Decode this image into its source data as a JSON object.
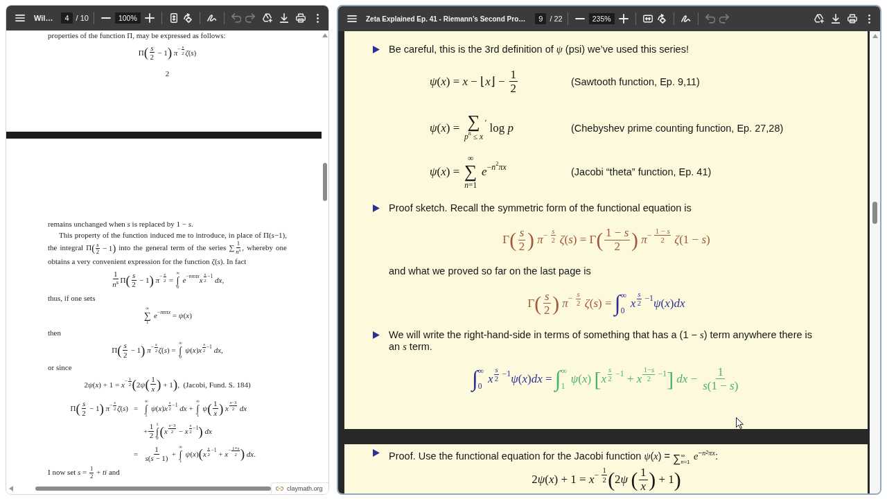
{
  "left_viewer": {
    "toolbar": {
      "title": "Wil…",
      "page": "4",
      "page_count": "/ 10",
      "zoom": "100%",
      "fit_button": {
        "kind": "page"
      },
      "undo": {
        "disabled": true
      },
      "redo": {
        "disabled": true
      }
    },
    "pages": [
      {
        "blocks": [
          {
            "kind": "paragraph",
            "indent": false,
            "items": [
              {
                "kind": "t",
                "text": "properties of the function Π, may be expressed as follows:"
              }
            ]
          },
          {
            "kind": "display",
            "parts": [
              {
                "items": [
                  {
                    "kind": "t",
                    "text": "Π"
                  },
                  {
                    "kind": "delim",
                    "open": "(",
                    "close": ")",
                    "items": [
                      {
                        "kind": "frac",
                        "num": "*s*",
                        "den": "2"
                      },
                      {
                        "kind": "t",
                        "text": " − 1"
                      }
                    ]
                  },
                  {
                    "kind": "t",
                    "text": " *π*"
                  },
                  {
                    "kind": "sup",
                    "items": [
                      {
                        "kind": "t",
                        "text": "−"
                      },
                      {
                        "kind": "frac",
                        "num": "*s*",
                        "den": "2"
                      }
                    ]
                  },
                  {
                    "kind": "t",
                    "text": "*ζ*(*s*)"
                  }
                ]
              }
            ]
          },
          {
            "kind": "page_number",
            "text": "2"
          }
        ]
      },
      {
        "blocks": [
          {
            "kind": "paragraph",
            "indent": false,
            "items": [
              {
                "kind": "t",
                "text": "remains unchanged when *s* is replaced by 1 − *s*."
              }
            ]
          },
          {
            "kind": "paragraph",
            "indent": true,
            "items": [
              {
                "kind": "t",
                "text": "This property of the function induced me to introduce, in place of Π(*s*−1), the integral Π"
              },
              {
                "kind": "delim",
                "open": "(",
                "close": ")",
                "items": [
                  {
                    "kind": "frac",
                    "num": "*s*",
                    "den": "2"
                  },
                  {
                    "kind": "t",
                    "text": " − 1"
                  }
                ]
              },
              {
                "kind": "t",
                "text": " into the general term of the series ∑"
              },
              {
                "kind": "frac",
                "num": "1",
                "den": [
                  {
                    "kind": "t",
                    "text": "*n*"
                  },
                  {
                    "kind": "sup",
                    "items": [
                      {
                        "kind": "t",
                        "text": "*s*"
                      }
                    ]
                  }
                ]
              },
              {
                "kind": "t",
                "text": ", whereby one obtains a very convenient expression for the function *ζ*(*s*). In fact"
              }
            ]
          },
          {
            "kind": "display",
            "parts": [
              {
                "items": [
                  {
                    "kind": "frac",
                    "num": "1",
                    "den": [
                      {
                        "kind": "t",
                        "text": "*n*"
                      },
                      {
                        "kind": "sup",
                        "items": [
                          {
                            "kind": "t",
                            "text": "*s*"
                          }
                        ]
                      }
                    ]
                  },
                  {
                    "kind": "t",
                    "text": "Π"
                  },
                  {
                    "kind": "delim",
                    "open": "(",
                    "close": ")",
                    "items": [
                      {
                        "kind": "frac",
                        "num": "*s*",
                        "den": "2"
                      },
                      {
                        "kind": "t",
                        "text": " − 1"
                      }
                    ]
                  },
                  {
                    "kind": "t",
                    "text": " *π*"
                  },
                  {
                    "kind": "sup",
                    "items": [
                      {
                        "kind": "t",
                        "text": "−"
                      },
                      {
                        "kind": "frac",
                        "num": "*s*",
                        "den": "2"
                      }
                    ]
                  },
                  {
                    "kind": "t",
                    "text": " = "
                  },
                  {
                    "kind": "op",
                    "symbol": "∫",
                    "upper": "∞",
                    "lower": "0"
                  },
                  {
                    "kind": "t",
                    "text": " *e*"
                  },
                  {
                    "kind": "sup",
                    "items": [
                      {
                        "kind": "t",
                        "text": "−*nnπx*"
                      }
                    ]
                  },
                  {
                    "kind": "t",
                    "text": "*x*"
                  },
                  {
                    "kind": "sup",
                    "items": [
                      {
                        "kind": "frac",
                        "num": "*s*",
                        "den": "2"
                      },
                      {
                        "kind": "t",
                        "text": "−1"
                      }
                    ]
                  },
                  {
                    "kind": "t",
                    "text": " *dx*,"
                  }
                ]
              }
            ]
          },
          {
            "kind": "paragraph",
            "indent": false,
            "items": [
              {
                "kind": "t",
                "text": "thus, if one sets"
              }
            ]
          },
          {
            "kind": "display",
            "parts": [
              {
                "items": [
                  {
                    "kind": "op",
                    "symbol": "∑",
                    "upper": "∞",
                    "lower": "1"
                  },
                  {
                    "kind": "t",
                    "text": " *e*"
                  },
                  {
                    "kind": "sup",
                    "items": [
                      {
                        "kind": "t",
                        "text": "−*nnπx*"
                      }
                    ]
                  },
                  {
                    "kind": "t",
                    "text": " = *ψ*(*x*)"
                  }
                ]
              }
            ]
          },
          {
            "kind": "paragraph",
            "indent": false,
            "items": [
              {
                "kind": "t",
                "text": "then"
              }
            ]
          },
          {
            "kind": "display",
            "parts": [
              {
                "items": [
                  {
                    "kind": "t",
                    "text": "Π"
                  },
                  {
                    "kind": "delim",
                    "open": "(",
                    "close": ")",
                    "items": [
                      {
                        "kind": "frac",
                        "num": "*s*",
                        "den": "2"
                      },
                      {
                        "kind": "t",
                        "text": " − 1"
                      }
                    ]
                  },
                  {
                    "kind": "t",
                    "text": " *π*"
                  },
                  {
                    "kind": "sup",
                    "items": [
                      {
                        "kind": "t",
                        "text": "−"
                      },
                      {
                        "kind": "frac",
                        "num": "*s*",
                        "den": "2"
                      }
                    ]
                  },
                  {
                    "kind": "t",
                    "text": "*ζ*(*s*) = "
                  },
                  {
                    "kind": "op",
                    "symbol": "∫",
                    "upper": "∞",
                    "lower": "0"
                  },
                  {
                    "kind": "t",
                    "text": " *ψ*(*x*)*x*"
                  },
                  {
                    "kind": "sup",
                    "items": [
                      {
                        "kind": "frac",
                        "num": "*s*",
                        "den": "2"
                      },
                      {
                        "kind": "t",
                        "text": "−1"
                      }
                    ]
                  },
                  {
                    "kind": "t",
                    "text": " *dx*,"
                  }
                ]
              }
            ]
          },
          {
            "kind": "paragraph",
            "indent": false,
            "items": [
              {
                "kind": "t",
                "text": "or since"
              }
            ]
          },
          {
            "kind": "display",
            "parts": [
              {
                "items": [
                  {
                    "kind": "t",
                    "text": "2"
                  },
                  {
                    "kind": "t",
                    "text": "*ψ*(*x*) + 1 = *x*"
                  },
                  {
                    "kind": "sup",
                    "items": [
                      {
                        "kind": "t",
                        "text": "−"
                      },
                      {
                        "kind": "frac",
                        "num": "1",
                        "den": "2"
                      }
                    ]
                  },
                  {
                    "kind": "delim",
                    "open": "(",
                    "close": ")",
                    "items": [
                      {
                        "kind": "t",
                        "text": "2"
                      },
                      {
                        "kind": "t",
                        "text": "*ψ*"
                      },
                      {
                        "kind": "delim",
                        "open": "(",
                        "close": ")",
                        "items": [
                          {
                            "kind": "frac",
                            "num": "1",
                            "den": "*x*"
                          }
                        ]
                      },
                      {
                        "kind": "t",
                        "text": " + 1"
                      }
                    ]
                  },
                  {
                    "kind": "t",
                    "text": ",  (Jacobi, Fund. S. 184)"
                  }
                ]
              }
            ]
          },
          {
            "kind": "aligned",
            "rows": [
              {
                "lhs": [
                  {
                    "kind": "t",
                    "text": "Π"
                  },
                  {
                    "kind": "delim",
                    "open": "(",
                    "close": ")",
                    "items": [
                      {
                        "kind": "frac",
                        "num": "*s*",
                        "den": "2"
                      },
                      {
                        "kind": "t",
                        "text": " − 1"
                      }
                    ]
                  },
                  {
                    "kind": "t",
                    "text": " *π*"
                  },
                  {
                    "kind": "sup",
                    "items": [
                      {
                        "kind": "t",
                        "text": "−"
                      },
                      {
                        "kind": "frac",
                        "num": "*s*",
                        "den": "2"
                      }
                    ]
                  },
                  {
                    "kind": "t",
                    "text": "*ζ*(*s*)"
                  }
                ],
                "rel": "=",
                "rhs": [
                  {
                    "kind": "op",
                    "symbol": "∫",
                    "upper": "∞",
                    "lower": "1"
                  },
                  {
                    "kind": "t",
                    "text": " *ψ*(*x*)*x*"
                  },
                  {
                    "kind": "sup",
                    "items": [
                      {
                        "kind": "frac",
                        "num": "*s*",
                        "den": "2"
                      },
                      {
                        "kind": "t",
                        "text": "−1"
                      }
                    ]
                  },
                  {
                    "kind": "t",
                    "text": " *dx* + "
                  },
                  {
                    "kind": "op",
                    "symbol": "∫",
                    "upper": "∞",
                    "lower": "1"
                  },
                  {
                    "kind": "t",
                    "text": " *ψ*"
                  },
                  {
                    "kind": "delim",
                    "open": "(",
                    "close": ")",
                    "items": [
                      {
                        "kind": "frac",
                        "num": "1",
                        "den": "*x*"
                      }
                    ]
                  },
                  {
                    "kind": "t",
                    "text": " *x*"
                  },
                  {
                    "kind": "sup",
                    "items": [
                      {
                        "kind": "frac",
                        "num": "*s*−3",
                        "den": "2"
                      }
                    ]
                  },
                  {
                    "kind": "t",
                    "text": " *dx*"
                  }
                ]
              },
              {
                "rhs": [
                  {
                    "kind": "t",
                    "text": "+"
                  },
                  {
                    "kind": "frac",
                    "num": "1",
                    "den": "2"
                  },
                  {
                    "kind": "op",
                    "symbol": "∫",
                    "upper": "1",
                    "lower": "0"
                  },
                  {
                    "kind": "delim",
                    "open": "(",
                    "close": ")",
                    "items": [
                      {
                        "kind": "t",
                        "text": "*x*"
                      },
                      {
                        "kind": "sup",
                        "items": [
                          {
                            "kind": "frac",
                            "num": "*s*−3",
                            "den": "2"
                          }
                        ]
                      },
                      {
                        "kind": "t",
                        "text": " − *x*"
                      },
                      {
                        "kind": "sup",
                        "items": [
                          {
                            "kind": "frac",
                            "num": "*s*",
                            "den": "2"
                          },
                          {
                            "kind": "t",
                            "text": "−1"
                          }
                        ]
                      }
                    ]
                  },
                  {
                    "kind": "t",
                    "text": " *dx*"
                  }
                ]
              },
              {
                "rel": "=",
                "rhs": [
                  {
                    "kind": "frac",
                    "num": "1",
                    "den": "*s*(*s* − 1)"
                  },
                  {
                    "kind": "t",
                    "text": " + "
                  },
                  {
                    "kind": "op",
                    "symbol": "∫",
                    "upper": "∞",
                    "lower": "1"
                  },
                  {
                    "kind": "t",
                    "text": " *ψ*(*x*)"
                  },
                  {
                    "kind": "delim",
                    "open": "(",
                    "close": ")",
                    "items": [
                      {
                        "kind": "t",
                        "text": "*x*"
                      },
                      {
                        "kind": "sup",
                        "items": [
                          {
                            "kind": "frac",
                            "num": "*s*",
                            "den": "2"
                          },
                          {
                            "kind": "t",
                            "text": "−1"
                          }
                        ]
                      },
                      {
                        "kind": "t",
                        "text": " + *x*"
                      },
                      {
                        "kind": "sup",
                        "items": [
                          {
                            "kind": "t",
                            "text": "−"
                          },
                          {
                            "kind": "frac",
                            "num": "1+*s*",
                            "den": "2"
                          }
                        ]
                      }
                    ]
                  },
                  {
                    "kind": "t",
                    "text": " *dx*."
                  }
                ]
              }
            ]
          },
          {
            "kind": "paragraph",
            "indent": false,
            "items": [
              {
                "kind": "t",
                "text": "I now set *s* = "
              },
              {
                "kind": "frac",
                "num": "1",
                "den": "2"
              },
              {
                "kind": "t",
                "text": " + *ti* and"
              }
            ]
          }
        ]
      }
    ],
    "source_chip": {
      "label": "claymath.org"
    }
  },
  "right_viewer": {
    "toolbar": {
      "title": "Zeta Explained Ep. 41 - Riemann’s Second Pro…",
      "page": "9",
      "page_count": "/ 22",
      "zoom": "235%",
      "fit_button": {
        "kind": "width"
      },
      "undo": {
        "disabled": true
      },
      "redo": {
        "disabled": true
      }
    },
    "slides": [
      {
        "blocks": [
          {
            "kind": "bullet",
            "items": [
              {
                "kind": "t",
                "text": "Be careful, this is the 3rd definition of *ψ* (psi) we’ve used this series!"
              }
            ]
          },
          {
            "kind": "definitions",
            "rows": [
              {
                "items": [
                  {
                    "kind": "t",
                    "text": "*ψ*(*x*) = *x* − ⌊*x*⌋ − "
                  },
                  {
                    "kind": "frac",
                    "num": "1",
                    "den": "2"
                  }
                ],
                "note": "(Sawtooth function, Ep. 9,11)"
              },
              {
                "items": [
                  {
                    "kind": "t",
                    "text": "*ψ*(*x*) = "
                  },
                  {
                    "kind": "op",
                    "symbol": "∑",
                    "lower": [
                      {
                        "kind": "t",
                        "text": "*p*"
                      },
                      {
                        "kind": "sup",
                        "items": [
                          {
                            "kind": "t",
                            "text": "*n*"
                          }
                        ]
                      },
                      {
                        "kind": "t",
                        "text": " ≤ *x*"
                      }
                    ]
                  },
                  {
                    "kind": "sup",
                    "items": [
                      {
                        "kind": "t",
                        "text": "′"
                      }
                    ]
                  },
                  {
                    "kind": "t",
                    "text": " log *p*"
                  }
                ],
                "note": "(Chebyshev prime counting function, Ep. 27,28)"
              },
              {
                "items": [
                  {
                    "kind": "t",
                    "text": "*ψ*(*x*) = "
                  },
                  {
                    "kind": "op",
                    "symbol": "∑",
                    "upper": "∞",
                    "lower": "*n*=1"
                  },
                  {
                    "kind": "t",
                    "text": " *e*"
                  },
                  {
                    "kind": "sup",
                    "items": [
                      {
                        "kind": "t",
                        "text": "−*n*"
                      },
                      {
                        "kind": "sup",
                        "items": [
                          {
                            "kind": "t",
                            "text": "2"
                          }
                        ]
                      },
                      {
                        "kind": "t",
                        "text": "*πx*"
                      }
                    ]
                  }
                ],
                "note": "(Jacobi “theta” function, Ep. 41)"
              }
            ]
          },
          {
            "kind": "bullet",
            "items": [
              {
                "kind": "t",
                "text": "Proof sketch. Recall the symmetric form of the functional equation is"
              }
            ]
          },
          {
            "kind": "display",
            "parts": [
              {
                "color": "#a0583a",
                "items": [
                  {
                    "kind": "t",
                    "text": "Γ"
                  },
                  {
                    "kind": "delim",
                    "open": "(",
                    "close": ")",
                    "items": [
                      {
                        "kind": "frac",
                        "num": "*s*",
                        "den": "2"
                      }
                    ]
                  },
                  {
                    "kind": "t",
                    "text": " *π*"
                  },
                  {
                    "kind": "sup",
                    "items": [
                      {
                        "kind": "t",
                        "text": "− "
                      },
                      {
                        "kind": "frac",
                        "num": "*s*",
                        "den": "2"
                      }
                    ]
                  },
                  {
                    "kind": "t",
                    "text": " *ζ*(*s*) = Γ"
                  },
                  {
                    "kind": "delim",
                    "open": "(",
                    "close": ")",
                    "items": [
                      {
                        "kind": "frac",
                        "num": "1 − *s*",
                        "den": "2"
                      }
                    ]
                  },
                  {
                    "kind": "t",
                    "text": " *π*"
                  },
                  {
                    "kind": "sup",
                    "items": [
                      {
                        "kind": "t",
                        "text": "− "
                      },
                      {
                        "kind": "frac",
                        "num": "1 − *s*",
                        "den": "2"
                      }
                    ]
                  },
                  {
                    "kind": "t",
                    "text": " *ζ*(1 − *s*)"
                  }
                ]
              }
            ]
          },
          {
            "kind": "text",
            "items": [
              {
                "kind": "t",
                "text": "and what we proved so far on the last page is"
              }
            ]
          },
          {
            "kind": "display",
            "parts": [
              {
                "color": "#a0583a",
                "items": [
                  {
                    "kind": "t",
                    "text": "Γ"
                  },
                  {
                    "kind": "delim",
                    "open": "(",
                    "close": ")",
                    "items": [
                      {
                        "kind": "frac",
                        "num": "*s*",
                        "den": "2"
                      }
                    ]
                  },
                  {
                    "kind": "t",
                    "text": " *π*"
                  },
                  {
                    "kind": "sup",
                    "items": [
                      {
                        "kind": "t",
                        "text": "− "
                      },
                      {
                        "kind": "frac",
                        "num": "*s*",
                        "den": "2"
                      }
                    ]
                  },
                  {
                    "kind": "t",
                    "text": " *ζ*(*s*) = "
                  }
                ]
              },
              {
                "color": "#2c2f96",
                "items": [
                  {
                    "kind": "op_side",
                    "symbol": "∫",
                    "upper": "∞",
                    "lower": "0"
                  },
                  {
                    "kind": "t",
                    "text": " *x*"
                  },
                  {
                    "kind": "sup",
                    "items": [
                      {
                        "kind": "frac",
                        "num": "*s*",
                        "den": "2"
                      },
                      {
                        "kind": "t",
                        "text": " −1"
                      }
                    ]
                  },
                  {
                    "kind": "t",
                    "text": "*ψ*(*x*)*dx*"
                  }
                ]
              }
            ]
          },
          {
            "kind": "bullet",
            "items": [
              {
                "kind": "t",
                "text": "We will write the right-hand-side in terms of something that has a (1 − *s*) term anywhere there is an *s* term."
              }
            ]
          },
          {
            "kind": "display",
            "parts": [
              {
                "color": "#2c2f96",
                "items": [
                  {
                    "kind": "op_side",
                    "symbol": "∫",
                    "upper": "∞",
                    "lower": "0"
                  },
                  {
                    "kind": "t",
                    "text": " *x*"
                  },
                  {
                    "kind": "sup",
                    "items": [
                      {
                        "kind": "frac",
                        "num": "*s*",
                        "den": "2"
                      },
                      {
                        "kind": "t",
                        "text": " −1"
                      }
                    ]
                  },
                  {
                    "kind": "t",
                    "text": "*ψ*(*x*)*dx* = "
                  }
                ]
              },
              {
                "color": "#4db26a",
                "items": [
                  {
                    "kind": "op_side",
                    "symbol": "∫",
                    "upper": "∞",
                    "lower": "1"
                  },
                  {
                    "kind": "t",
                    "text": " *ψ*(*x*) "
                  },
                  {
                    "kind": "delim",
                    "open": "[",
                    "close": "]",
                    "items": [
                      {
                        "kind": "t",
                        "text": "*x*"
                      },
                      {
                        "kind": "sup",
                        "items": [
                          {
                            "kind": "frac",
                            "num": "*s*",
                            "den": "2"
                          },
                          {
                            "kind": "t",
                            "text": " −1"
                          }
                        ]
                      },
                      {
                        "kind": "t",
                        "text": " + *x*"
                      },
                      {
                        "kind": "sup",
                        "items": [
                          {
                            "kind": "frac",
                            "num": "1−*s*",
                            "den": "2"
                          },
                          {
                            "kind": "t",
                            "text": " −1"
                          }
                        ]
                      }
                    ]
                  },
                  {
                    "kind": "t",
                    "text": " *dx* − "
                  },
                  {
                    "kind": "frac",
                    "num": "1",
                    "den": "*s*(1 − *s*)"
                  }
                ]
              }
            ]
          }
        ]
      },
      {
        "blocks": [
          {
            "kind": "bullet",
            "items": [
              {
                "kind": "t",
                "text": "Proof. Use the functional equation for the Jacobi function *ψ*(*x*) = "
              },
              {
                "kind": "op_side",
                "symbol": "∑",
                "upper": "∞",
                "lower": "*n*=1"
              },
              {
                "kind": "t",
                "text": " *e*"
              },
              {
                "kind": "sup",
                "items": [
                  {
                    "kind": "t",
                    "text": "−*n*"
                  },
                  {
                    "kind": "sup",
                    "items": [
                      {
                        "kind": "t",
                        "text": "2"
                      }
                    ]
                  },
                  {
                    "kind": "t",
                    "text": "*πx*"
                  }
                ]
              },
              {
                "kind": "t",
                "text": ":"
              }
            ]
          },
          {
            "kind": "display",
            "parts": [
              {
                "items": [
                  {
                    "kind": "t",
                    "text": "2"
                  },
                  {
                    "kind": "t",
                    "text": "*ψ*(*x*) + 1 = *x*"
                  },
                  {
                    "kind": "sup",
                    "items": [
                      {
                        "kind": "t",
                        "text": "− "
                      },
                      {
                        "kind": "frac",
                        "num": "1",
                        "den": "2"
                      }
                    ]
                  },
                  {
                    "kind": "delim",
                    "open": "(",
                    "close": ")",
                    "items": [
                      {
                        "kind": "t",
                        "text": "2"
                      },
                      {
                        "kind": "t",
                        "text": "*ψ* "
                      },
                      {
                        "kind": "delim",
                        "open": "(",
                        "close": ")",
                        "items": [
                          {
                            "kind": "frac",
                            "num": "1",
                            "den": "*x*"
                          }
                        ]
                      },
                      {
                        "kind": "t",
                        "text": " + 1"
                      }
                    ]
                  }
                ]
              }
            ]
          }
        ]
      }
    ]
  }
}
